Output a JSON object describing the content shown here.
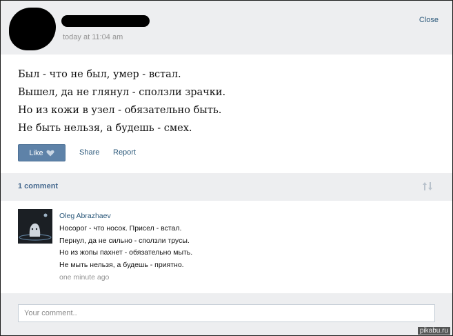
{
  "post": {
    "time": "today at 11:04 am",
    "close_label": "Close",
    "lines": [
      "Был - что не был, умер - встал.",
      "Вышел, да не глянул - сползли зрачки.",
      "Но из кожи в узел - обязательно быть.",
      "Не быть нельзя, а будешь - смех."
    ]
  },
  "actions": {
    "like_label": "Like",
    "share_label": "Share",
    "report_label": "Report"
  },
  "comments": {
    "count_label": "1 comment",
    "items": [
      {
        "author": "Oleg Abrazhaev",
        "lines": [
          "Носорог - что носок. Присел - встал.",
          "Пернул, да не сильно - сползли трусы.",
          "Но из жопы пахнет - обязательно мыть.",
          "Не мыть нельзя, а будешь - приятно."
        ],
        "time": "one minute ago"
      }
    ]
  },
  "composer": {
    "placeholder": "Your comment.."
  },
  "watermark": "pikabu.ru",
  "icons": {
    "like": "heart-icon",
    "sort": "sort-arrows-icon"
  },
  "colors": {
    "link": "#2b587a",
    "like_button": "#5e82a8",
    "panel_bg": "#edeef0"
  }
}
